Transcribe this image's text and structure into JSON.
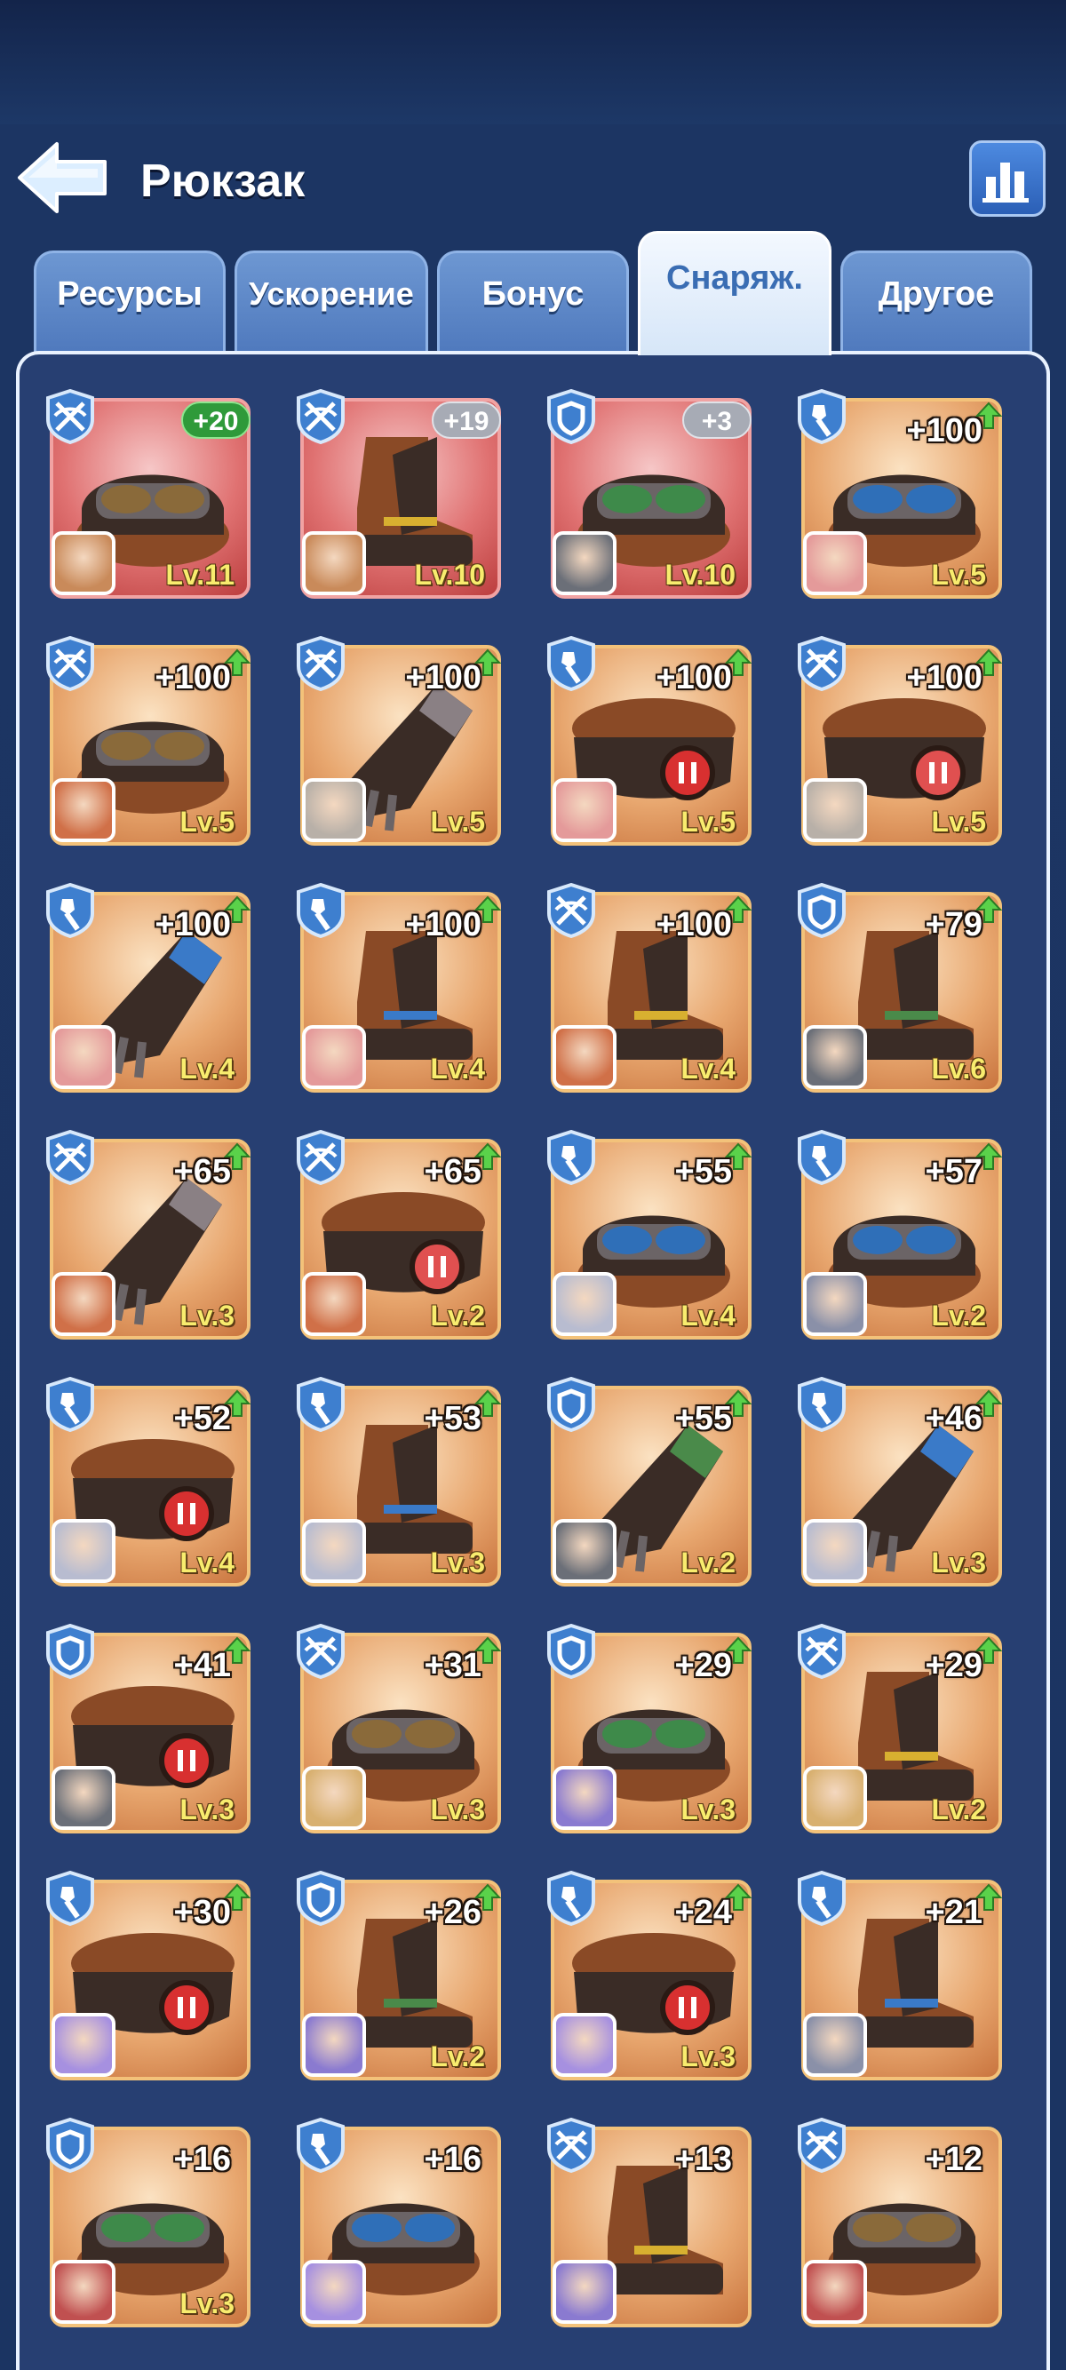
{
  "header": {
    "title": "Рюкзак"
  },
  "tabs": [
    {
      "label": "Ресурсы",
      "active": false
    },
    {
      "label": "Ускорение",
      "active": false
    },
    {
      "label": "Бонус",
      "active": false
    },
    {
      "label": "Снаряж.",
      "active": true
    },
    {
      "label": "Другое",
      "active": false
    }
  ],
  "items": [
    {
      "role": "crossbow",
      "gear": "goggles",
      "bg": "red",
      "badge": "+20",
      "badge_color": "green",
      "upgrade": false,
      "level": "Lv.11",
      "hero": "#c98a5a"
    },
    {
      "role": "crossbow",
      "gear": "boot",
      "bg": "red",
      "badge": "+19",
      "badge_color": "grey",
      "upgrade": false,
      "level": "Lv.10",
      "hero": "#c98a5a"
    },
    {
      "role": "shield",
      "gear": "goggles-green",
      "bg": "red",
      "badge": "+3",
      "badge_color": "grey",
      "upgrade": false,
      "level": "Lv.10",
      "hero": "#6b6f78"
    },
    {
      "role": "shovel",
      "gear": "goggles-blue",
      "bg": "orange",
      "plus": "+100",
      "upgrade": true,
      "level": "Lv.5",
      "hero": "#e49a9a"
    },
    {
      "role": "crossbow",
      "gear": "goggles",
      "bg": "orange",
      "plus": "+100",
      "upgrade": true,
      "level": "Lv.5",
      "hero": "#d07048"
    },
    {
      "role": "crossbow",
      "gear": "glove",
      "bg": "orange",
      "plus": "+100",
      "upgrade": true,
      "level": "Lv.5",
      "hero": "#b8b0a8"
    },
    {
      "role": "shovel",
      "gear": "belt-red",
      "bg": "orange",
      "plus": "+100",
      "upgrade": true,
      "level": "Lv.5",
      "hero": "#e49a9a"
    },
    {
      "role": "crossbow",
      "gear": "belt-stripe",
      "bg": "orange",
      "plus": "+100",
      "upgrade": true,
      "level": "Lv.5",
      "hero": "#b8b0a8"
    },
    {
      "role": "shovel",
      "gear": "glove-blue",
      "bg": "orange",
      "plus": "+100",
      "upgrade": true,
      "level": "Lv.4",
      "hero": "#e49a9a"
    },
    {
      "role": "shovel",
      "gear": "boot-blue",
      "bg": "orange",
      "plus": "+100",
      "upgrade": true,
      "level": "Lv.4",
      "hero": "#e49a9a"
    },
    {
      "role": "crossbow",
      "gear": "boot",
      "bg": "orange",
      "plus": "+100",
      "upgrade": true,
      "level": "Lv.4",
      "hero": "#d07048"
    },
    {
      "role": "shield",
      "gear": "boot-green",
      "bg": "orange",
      "plus": "+79",
      "upgrade": true,
      "level": "Lv.6",
      "hero": "#6b6f78"
    },
    {
      "role": "crossbow",
      "gear": "glove",
      "bg": "orange",
      "plus": "+65",
      "upgrade": true,
      "level": "Lv.3",
      "hero": "#d07048"
    },
    {
      "role": "crossbow",
      "gear": "belt-stripe",
      "bg": "orange",
      "plus": "+65",
      "upgrade": true,
      "level": "Lv.2",
      "hero": "#d07048"
    },
    {
      "role": "shovel",
      "gear": "goggles-blue",
      "bg": "orange",
      "plus": "+55",
      "upgrade": true,
      "level": "Lv.4",
      "hero": "#b8bcd0"
    },
    {
      "role": "shovel",
      "gear": "goggles-blue",
      "bg": "orange",
      "plus": "+57",
      "upgrade": true,
      "level": "Lv.2",
      "hero": "#8a90a8"
    },
    {
      "role": "shovel",
      "gear": "belt-red",
      "bg": "orange",
      "plus": "+52",
      "upgrade": true,
      "level": "Lv.4",
      "hero": "#b8bcd0"
    },
    {
      "role": "shovel",
      "gear": "boot-blue",
      "bg": "orange",
      "plus": "+53",
      "upgrade": true,
      "level": "Lv.3",
      "hero": "#b8bcd0"
    },
    {
      "role": "shield",
      "gear": "glove-green",
      "bg": "orange",
      "plus": "+55",
      "upgrade": true,
      "level": "Lv.2",
      "hero": "#6b6f78"
    },
    {
      "role": "shovel",
      "gear": "glove-blue",
      "bg": "orange",
      "plus": "+46",
      "upgrade": true,
      "level": "Lv.3",
      "hero": "#b8bcd0"
    },
    {
      "role": "shield",
      "gear": "belt-red",
      "bg": "orange",
      "plus": "+41",
      "upgrade": true,
      "level": "Lv.3",
      "hero": "#6b6f78"
    },
    {
      "role": "crossbow",
      "gear": "goggles",
      "bg": "orange",
      "plus": "+31",
      "upgrade": true,
      "level": "Lv.3",
      "hero": "#d8b070"
    },
    {
      "role": "shield",
      "gear": "goggles-green",
      "bg": "orange",
      "plus": "+29",
      "upgrade": true,
      "level": "Lv.3",
      "hero": "#8a7ad0"
    },
    {
      "role": "crossbow",
      "gear": "boot",
      "bg": "orange",
      "plus": "+29",
      "upgrade": true,
      "level": "Lv.2",
      "hero": "#d8b070"
    },
    {
      "role": "shovel",
      "gear": "belt-red",
      "bg": "orange",
      "plus": "+30",
      "upgrade": true,
      "level": "",
      "hero": "#a690e0"
    },
    {
      "role": "shield",
      "gear": "boot-green",
      "bg": "orange",
      "plus": "+26",
      "upgrade": true,
      "level": "Lv.2",
      "hero": "#8a7ad0"
    },
    {
      "role": "shovel",
      "gear": "belt-red",
      "bg": "orange",
      "plus": "+24",
      "upgrade": true,
      "level": "Lv.3",
      "hero": "#a690e0"
    },
    {
      "role": "shovel",
      "gear": "boot-blue",
      "bg": "orange",
      "plus": "+21",
      "upgrade": true,
      "level": "",
      "hero": "#8a90a8"
    },
    {
      "role": "shield",
      "gear": "goggles-green",
      "bg": "orange",
      "plus": "+16",
      "upgrade": false,
      "level": "Lv.3",
      "hero": "#c05050"
    },
    {
      "role": "shovel",
      "gear": "goggles-blue",
      "bg": "orange",
      "plus": "+16",
      "upgrade": false,
      "level": "",
      "hero": "#a690e0"
    },
    {
      "role": "crossbow",
      "gear": "boot",
      "bg": "orange",
      "plus": "+13",
      "upgrade": false,
      "level": "",
      "hero": "#8a7ad0"
    },
    {
      "role": "crossbow",
      "gear": "goggles",
      "bg": "orange",
      "plus": "+12",
      "upgrade": false,
      "level": "",
      "hero": "#c05050"
    }
  ]
}
